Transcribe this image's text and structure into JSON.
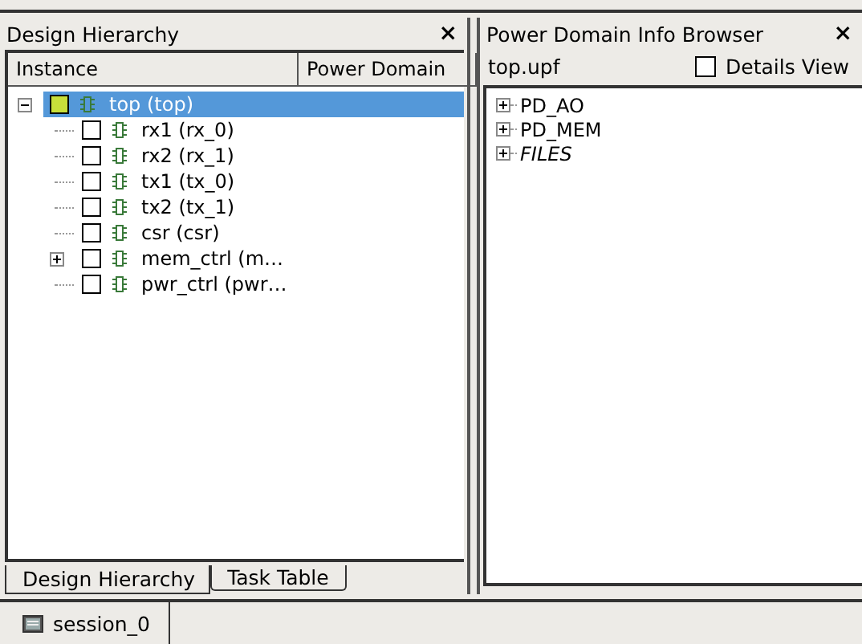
{
  "left_panel": {
    "title": "Design Hierarchy",
    "close": "×",
    "columns": [
      "Instance",
      "Power Domain"
    ],
    "tree": [
      {
        "label": "top (top)",
        "selected": true,
        "checked": true,
        "expanded": true,
        "children": [
          {
            "label": "rx1 (rx_0)",
            "selected": false,
            "checked": false
          },
          {
            "label": "rx2 (rx_1)",
            "selected": false,
            "checked": false
          },
          {
            "label": "tx1 (tx_0)",
            "selected": false,
            "checked": false
          },
          {
            "label": "tx2 (tx_1)",
            "selected": false,
            "checked": false
          },
          {
            "label": "csr (csr)",
            "selected": false,
            "checked": false
          },
          {
            "label": "mem_ctrl (m…",
            "selected": false,
            "checked": false,
            "expanded": false
          },
          {
            "label": "pwr_ctrl (pwr…",
            "selected": false,
            "checked": false
          }
        ]
      }
    ],
    "tabs": [
      {
        "label": "Design Hierarchy",
        "selected": true
      },
      {
        "label": "Task Table",
        "selected": false
      }
    ]
  },
  "right_panel": {
    "title": "Power Domain Info Browser",
    "close": "×",
    "file": "top.upf",
    "details_view": {
      "label": "Details View",
      "checked": false
    },
    "items": [
      {
        "label": "PD_AO",
        "kind": "domain",
        "expanded": false
      },
      {
        "label": "PD_MEM",
        "kind": "domain",
        "expanded": false
      },
      {
        "label": "FILES",
        "kind": "files",
        "expanded": false
      }
    ]
  },
  "session_tabs": [
    {
      "label": "session_0",
      "selected": true
    }
  ]
}
